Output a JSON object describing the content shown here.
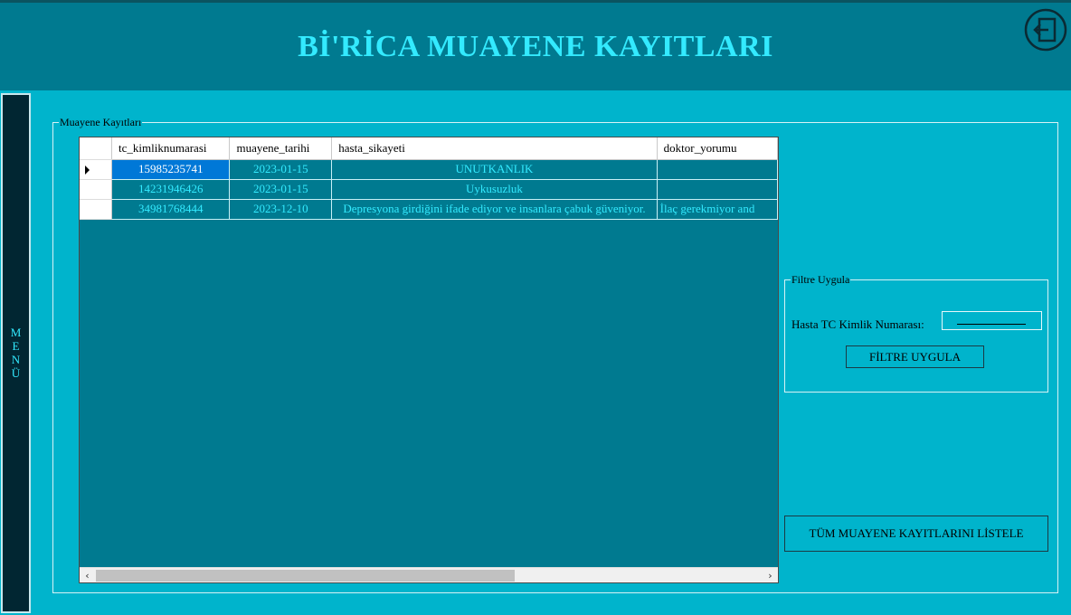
{
  "header": {
    "title": "Bİ'RİCA MUAYENE KAYITLARI",
    "exit_icon": "exit-door-arrow-icon"
  },
  "side_menu": {
    "letters": [
      "M",
      "E",
      "N",
      "Ü"
    ]
  },
  "records_group": {
    "legend": "Muayene Kayıtları"
  },
  "grid": {
    "columns": [
      "tc_kimliknumarasi",
      "muayene_tarihi",
      "hasta_sikayeti",
      "doktor_yorumu"
    ],
    "rows": [
      {
        "tc": "15985235741",
        "date": "2023-01-15",
        "complaint": "UNUTKANLIK",
        "comment": ""
      },
      {
        "tc": "14231946426",
        "date": "2023-01-15",
        "complaint": "Uykusuzluk",
        "comment": ""
      },
      {
        "tc": "34981768444",
        "date": "2023-12-10",
        "complaint": "Depresyona girdiğini ifade ediyor ve insanlara çabuk güveniyor.",
        "comment": "İlaç gerekmiyor and"
      }
    ],
    "selected_row": 0
  },
  "filter": {
    "legend": "Filtre Uygula",
    "label": "Hasta TC Kimlik Numarası:",
    "input_value": "",
    "button": "FİLTRE UYGULA"
  },
  "list_all_button": "TÜM MUAYENE KAYITLARINI LİSTELE",
  "colors": {
    "header_bg": "#007a90",
    "body_bg": "#00b4cc",
    "title": "#33eaff",
    "menu_bg": "#012632",
    "selection": "#0078d7"
  }
}
